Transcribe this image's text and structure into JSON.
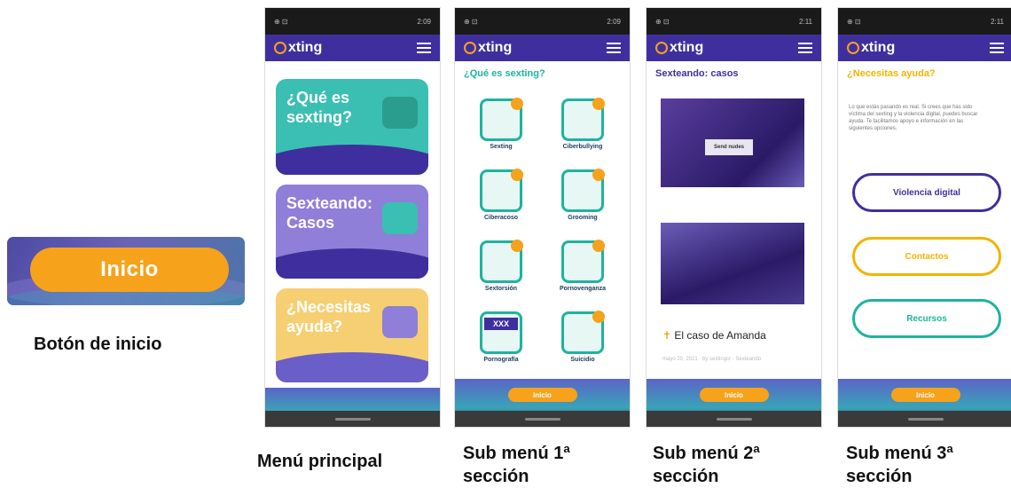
{
  "start_sample": {
    "button_label": "Inicio",
    "caption": "Botón de inicio"
  },
  "captions": {
    "main_menu": "Menú principal",
    "sub1": "Sub menú 1ª sección",
    "sub2": "Sub menú 2ª sección",
    "sub3": "Sub menú 3ª sección"
  },
  "app": {
    "logo_text": "xting",
    "status_left": "⊕ ⊡",
    "times": [
      "2:09",
      "2:09",
      "2:11",
      "2:11"
    ],
    "footer_button": "Inicio"
  },
  "main_menu": {
    "cards": [
      {
        "label": "¿Qué es sexting?",
        "color": "#3bbfb2"
      },
      {
        "label": "Sexteando: Casos",
        "color": "#8f7fd8"
      },
      {
        "label": "¿Necesitas ayuda?",
        "color": "#f6cf72"
      }
    ]
  },
  "sub1": {
    "title": "¿Qué es sexting?",
    "items": [
      "Sexting",
      "Ciberbullying",
      "Ciberacoso",
      "Grooming",
      "Sextorsión",
      "Pornovenganza",
      "Pornografía",
      "Suicidio"
    ],
    "badge": "XXX"
  },
  "sub2": {
    "title": "Sexteando: casos",
    "overlay": "Send nudes",
    "case_title": "El caso de Amanda",
    "meta": "mayo 20, 2021 · by sextingcr · Sexteando"
  },
  "sub3": {
    "title": "¿Necesitas ayuda?",
    "intro": "Lo que estás pasando es real. Si crees que has sido víctima del sexting y la violencia digital, puedes buscar ayuda. Te facilitamos apoyo e información en las siguientes opciones.",
    "buttons": [
      {
        "label": "Violencia digital",
        "color": "#3f2f9e"
      },
      {
        "label": "Contactos",
        "color": "#f0b400"
      },
      {
        "label": "Recursos",
        "color": "#1eb3a0"
      }
    ]
  }
}
